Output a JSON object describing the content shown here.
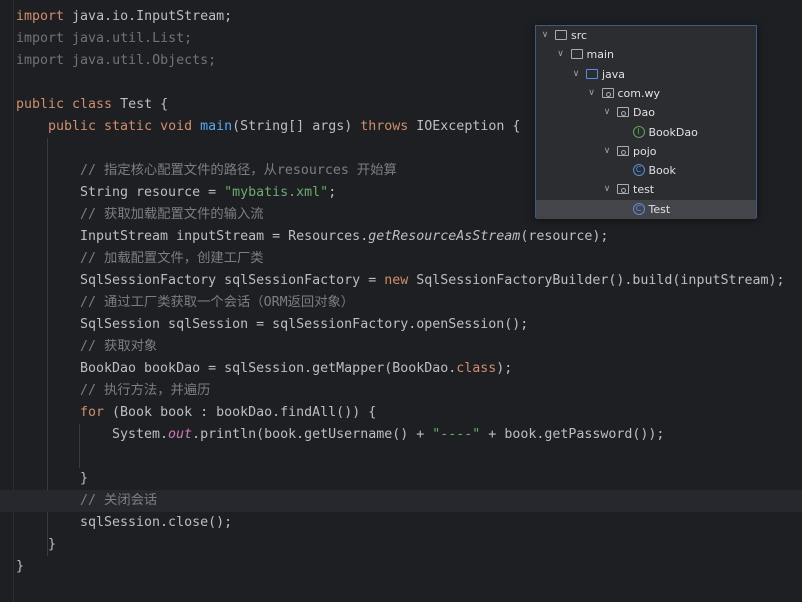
{
  "editor": {
    "current_line": 22,
    "lines": [
      {
        "indent": 0,
        "tokens": [
          {
            "t": "import ",
            "c": "k"
          },
          {
            "t": "java.io.InputStream;",
            "c": "t"
          }
        ]
      },
      {
        "indent": 0,
        "tokens": [
          {
            "t": "import java.util.List;",
            "c": "d"
          }
        ]
      },
      {
        "indent": 0,
        "tokens": [
          {
            "t": "import java.util.Objects;",
            "c": "d"
          }
        ]
      },
      {
        "indent": 0,
        "tokens": []
      },
      {
        "indent": 0,
        "tokens": [
          {
            "t": "public class ",
            "c": "k"
          },
          {
            "t": "Test {",
            "c": "t"
          }
        ]
      },
      {
        "indent": 1,
        "tokens": [
          {
            "t": "public static void ",
            "c": "k"
          },
          {
            "t": "main",
            "c": "m"
          },
          {
            "t": "(String[] args) ",
            "c": "t"
          },
          {
            "t": "throws ",
            "c": "k"
          },
          {
            "t": "IOException {",
            "c": "t"
          }
        ]
      },
      {
        "indent": 0,
        "tokens": []
      },
      {
        "indent": 2,
        "tokens": [
          {
            "t": "// 指定核心配置文件的路径，从resources 开始算",
            "c": "c"
          }
        ]
      },
      {
        "indent": 2,
        "tokens": [
          {
            "t": "String resource = ",
            "c": "t"
          },
          {
            "t": "\"mybatis.xml\"",
            "c": "s"
          },
          {
            "t": ";",
            "c": "t"
          }
        ]
      },
      {
        "indent": 2,
        "tokens": [
          {
            "t": "// 获取加载配置文件的输入流",
            "c": "c"
          }
        ]
      },
      {
        "indent": 2,
        "tokens": [
          {
            "t": "InputStream inputStream = Resources.",
            "c": "t"
          },
          {
            "t": "getResourceAsStream",
            "c": "i"
          },
          {
            "t": "(resource);",
            "c": "t"
          }
        ]
      },
      {
        "indent": 2,
        "tokens": [
          {
            "t": "// 加载配置文件，创建工厂类",
            "c": "c"
          }
        ]
      },
      {
        "indent": 2,
        "tokens": [
          {
            "t": "SqlSessionFactory sqlSessionFactory = ",
            "c": "t"
          },
          {
            "t": "new ",
            "c": "k"
          },
          {
            "t": "SqlSessionFactoryBuilder().build(inputStream);",
            "c": "t"
          }
        ]
      },
      {
        "indent": 2,
        "tokens": [
          {
            "t": "// 通过工厂类获取一个会话（ORM返回对象）",
            "c": "c"
          }
        ]
      },
      {
        "indent": 2,
        "tokens": [
          {
            "t": "SqlSession sqlSession = sqlSessionFactory.openSession();",
            "c": "t"
          }
        ]
      },
      {
        "indent": 2,
        "tokens": [
          {
            "t": "// 获取对象",
            "c": "c"
          }
        ]
      },
      {
        "indent": 2,
        "tokens": [
          {
            "t": "BookDao bookDao = sqlSession.getMapper(BookDao.",
            "c": "t"
          },
          {
            "t": "class",
            "c": "k"
          },
          {
            "t": ");",
            "c": "t"
          }
        ]
      },
      {
        "indent": 2,
        "tokens": [
          {
            "t": "// 执行方法，并遍历",
            "c": "c"
          }
        ]
      },
      {
        "indent": 2,
        "tokens": [
          {
            "t": "for ",
            "c": "k"
          },
          {
            "t": "(Book book : bookDao.findAll()) {",
            "c": "t"
          }
        ]
      },
      {
        "indent": 3,
        "tokens": [
          {
            "t": "System.",
            "c": "t"
          },
          {
            "t": "out",
            "c": "f"
          },
          {
            "t": ".println(book.getUsername() + ",
            "c": "t"
          },
          {
            "t": "\"----\"",
            "c": "s"
          },
          {
            "t": " + book.getPassword());",
            "c": "t"
          }
        ]
      },
      {
        "indent": 0,
        "tokens": []
      },
      {
        "indent": 2,
        "tokens": [
          {
            "t": "}",
            "c": "t"
          }
        ]
      },
      {
        "indent": 2,
        "tokens": [
          {
            "t": "// 关闭会话",
            "c": "c"
          }
        ]
      },
      {
        "indent": 2,
        "tokens": [
          {
            "t": "sqlSession.close();",
            "c": "t"
          }
        ]
      },
      {
        "indent": 1,
        "tokens": [
          {
            "t": "}",
            "c": "t"
          }
        ]
      },
      {
        "indent": 0,
        "tokens": [
          {
            "t": "}",
            "c": "t"
          }
        ]
      }
    ]
  },
  "project_tree": {
    "nodes": [
      {
        "label": "src",
        "depth": 0,
        "icon": "folder-icon",
        "expanded": true
      },
      {
        "label": "main",
        "depth": 1,
        "icon": "folder-icon",
        "expanded": true
      },
      {
        "label": "java",
        "depth": 2,
        "icon": "source-folder-icon",
        "expanded": true
      },
      {
        "label": "com.wy",
        "depth": 3,
        "icon": "package-icon",
        "expanded": true
      },
      {
        "label": "Dao",
        "depth": 4,
        "icon": "package-icon",
        "expanded": true
      },
      {
        "label": "BookDao",
        "depth": 5,
        "icon": "interface-icon",
        "glyph": "I"
      },
      {
        "label": "pojo",
        "depth": 4,
        "icon": "package-icon",
        "expanded": true
      },
      {
        "label": "Book",
        "depth": 5,
        "icon": "class-icon",
        "glyph": "C"
      },
      {
        "label": "test",
        "depth": 4,
        "icon": "package-icon",
        "expanded": true
      },
      {
        "label": "Test",
        "depth": 5,
        "icon": "class-icon",
        "glyph": "C",
        "selected": true
      }
    ]
  }
}
